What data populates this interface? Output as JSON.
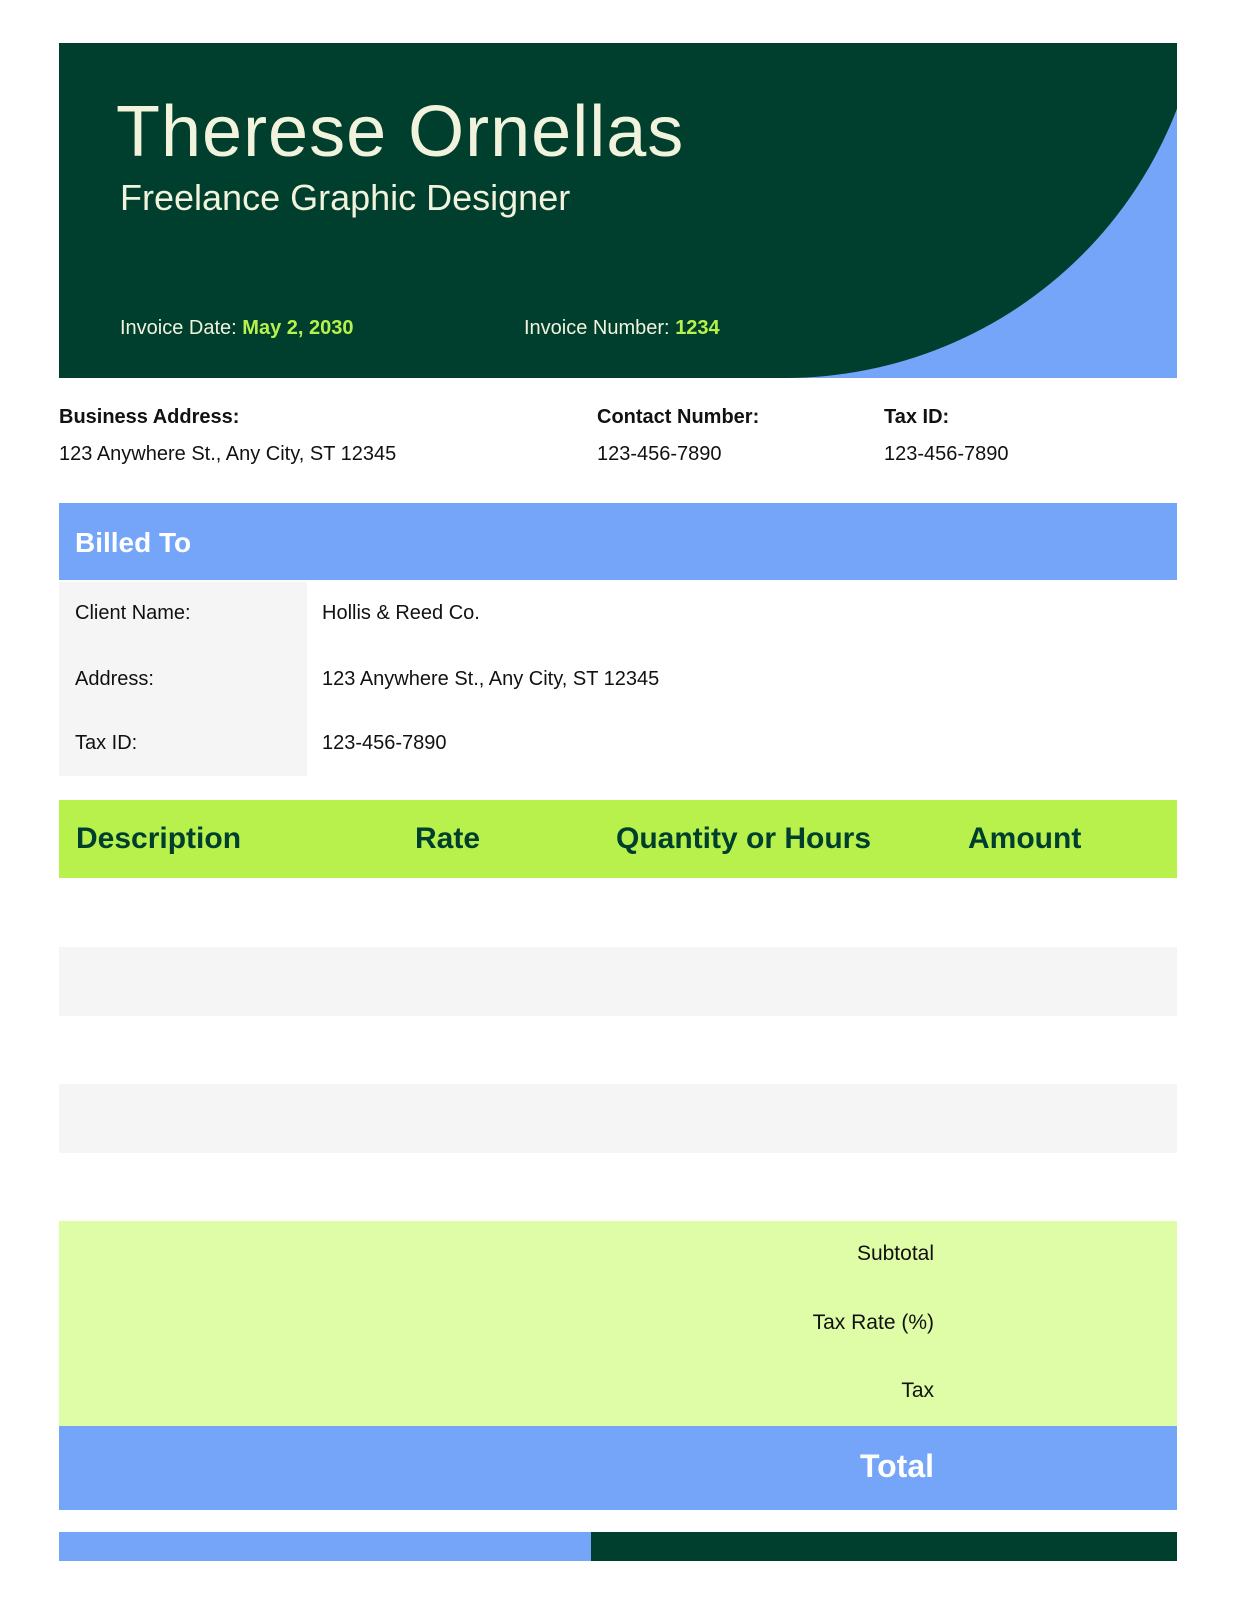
{
  "header": {
    "name": "Therese Ornellas",
    "title": "Freelance Graphic Designer",
    "invoice_date_label": "Invoice Date:",
    "invoice_date": "May 2, 2030",
    "invoice_number_label": "Invoice Number:",
    "invoice_number": "1234"
  },
  "info": {
    "business_address_label": "Business Address:",
    "business_address": "123 Anywhere St., Any City, ST 12345",
    "contact_number_label": "Contact Number:",
    "contact_number": "123-456-7890",
    "tax_id_label": "Tax ID:",
    "tax_id": "123-456-7890"
  },
  "billed_to": {
    "heading": "Billed To",
    "rows": [
      {
        "label": "Client Name:",
        "value": "Hollis & Reed Co."
      },
      {
        "label": "Address:",
        "value": "123 Anywhere St., Any City, ST 12345"
      },
      {
        "label": "Tax ID:",
        "value": "123-456-7890"
      }
    ]
  },
  "table": {
    "columns": [
      "Description",
      "Rate",
      "Quantity or Hours",
      "Amount"
    ]
  },
  "totals": {
    "subtotal_label": "Subtotal",
    "tax_rate_label": "Tax Rate (%)",
    "tax_label": "Tax",
    "total_label": "Total"
  },
  "colors": {
    "dark_green": "#003f2e",
    "blue": "#74a5f8",
    "lime": "#b8f04c",
    "light_lime": "#dffca6",
    "cream": "#f1f3dc"
  }
}
